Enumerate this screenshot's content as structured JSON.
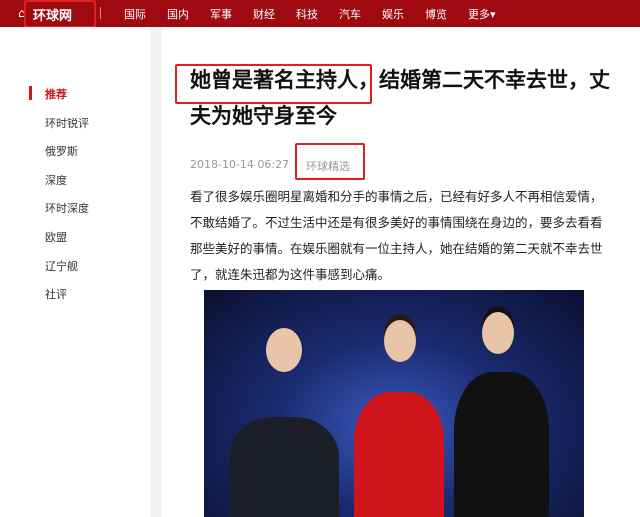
{
  "header": {
    "logo": "环球网",
    "nav": [
      "国际",
      "国内",
      "军事",
      "财经",
      "科技",
      "汽车",
      "娱乐",
      "博览",
      "更多▾"
    ]
  },
  "sidebar": {
    "items": [
      "推荐",
      "环时锐评",
      "俄罗斯",
      "深度",
      "环时深度",
      "欧盟",
      "辽宁舰",
      "社评"
    ]
  },
  "article": {
    "title": "她曾是著名主持人，结婚第二天不幸去世，丈夫为她守身至今",
    "date": "2018-10-14 06:27",
    "source": "环球精选",
    "body": "看了很多娱乐圈明星离婚和分手的事情之后，已经有好多人不再相信爱情，不敢结婚了。不过生活中还是有很多美好的事情围绕在身边的，要多去看看那些美好的事情。在娱乐圈就有一位主持人，她在结婚的第二天就不幸去世了，就连朱迅都为这件事感到心痛。"
  },
  "colors": {
    "header": "#9e0a10",
    "accent": "#d01818",
    "highlight": "#e02020"
  }
}
